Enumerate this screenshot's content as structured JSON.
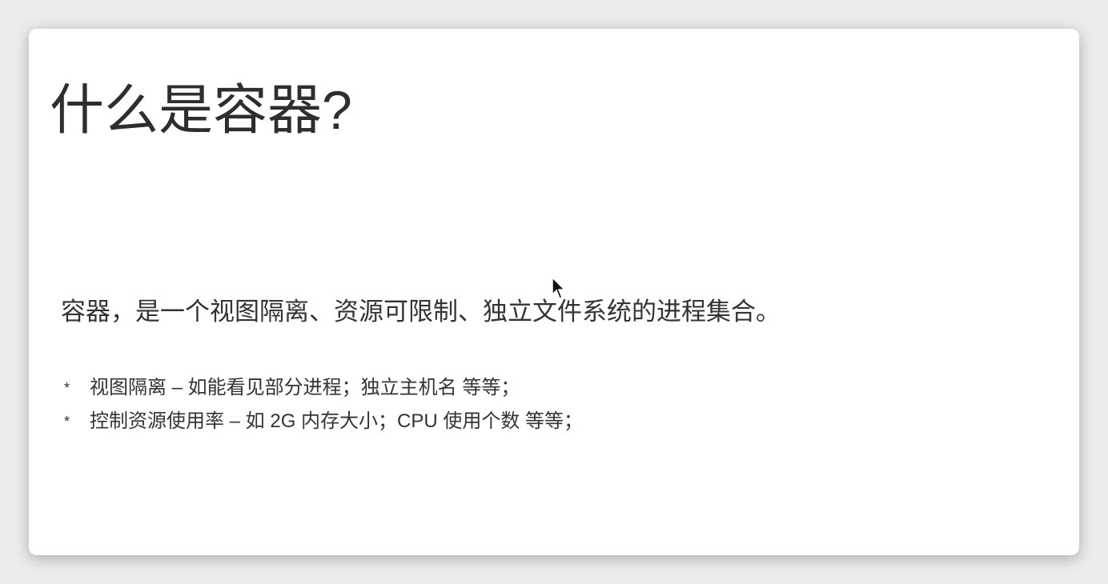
{
  "slide": {
    "title": "什么是容器?",
    "lead": "容器，是一个视图隔离、资源可限制、独立文件系统的进程集合。",
    "bullets": [
      {
        "marker": "*",
        "text": "视图隔离 – 如能看见部分进程；独立主机名 等等；"
      },
      {
        "marker": "*",
        "text": "控制资源使用率 – 如 2G 内存大小；CPU 使用个数 等等；"
      }
    ]
  },
  "colors": {
    "background": "#ececec",
    "slide": "#ffffff",
    "text": "#333333"
  }
}
